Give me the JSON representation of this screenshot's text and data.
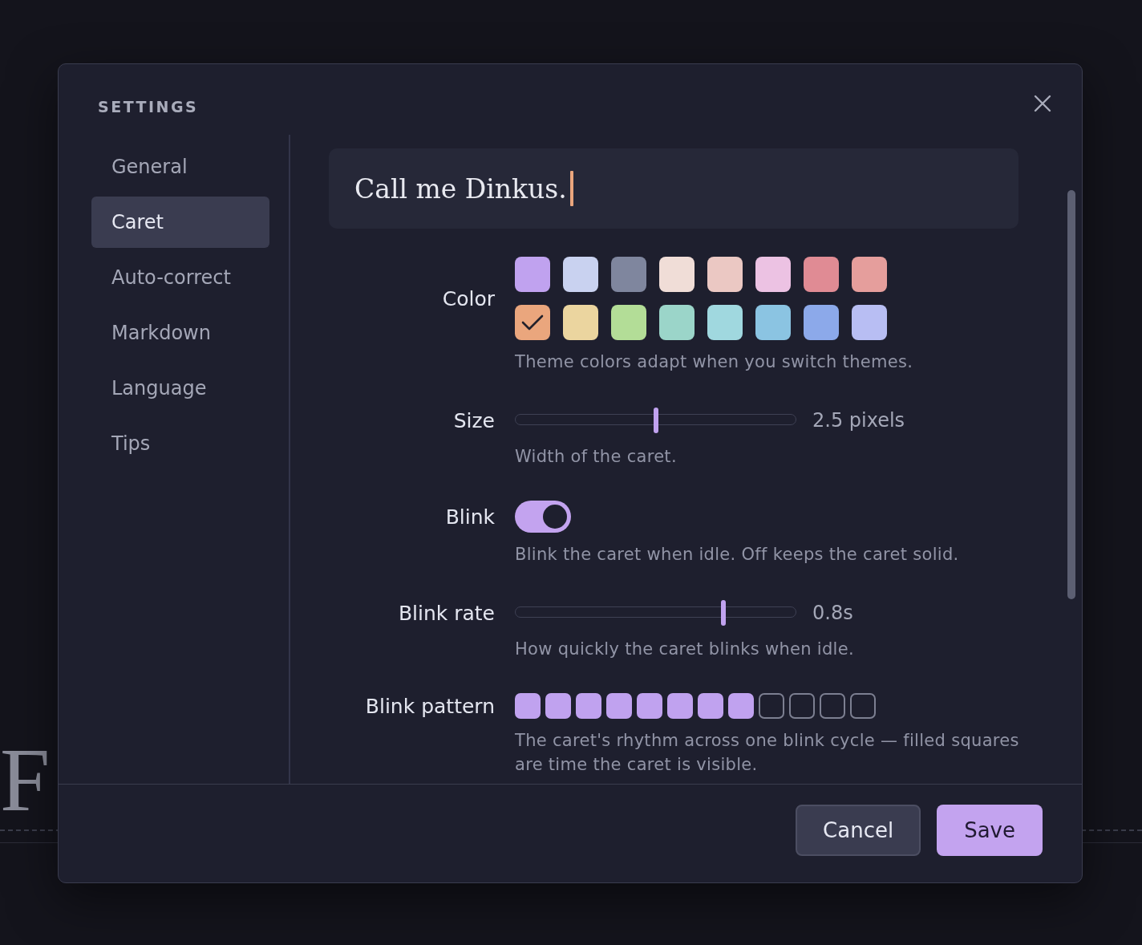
{
  "background": {
    "heading": "F"
  },
  "dialog": {
    "title": "SETTINGS",
    "sidebar": {
      "items": [
        {
          "label": "General",
          "selected": false
        },
        {
          "label": "Caret",
          "selected": true
        },
        {
          "label": "Auto-correct",
          "selected": false
        },
        {
          "label": "Markdown",
          "selected": false
        },
        {
          "label": "Language",
          "selected": false
        },
        {
          "label": "Tips",
          "selected": false
        }
      ]
    },
    "preview": {
      "text": "Call me Dinkus."
    },
    "settings": [
      {
        "kind": "colors",
        "label": "Color",
        "hint": "Theme colors adapt when you switch themes.",
        "swatches": [
          {
            "color": "#c0a2ef",
            "selected": false
          },
          {
            "color": "#c9d2f0",
            "selected": false
          },
          {
            "color": "#7f869e",
            "selected": false
          },
          {
            "color": "#f0ddd7",
            "selected": false
          },
          {
            "color": "#ebc8c3",
            "selected": false
          },
          {
            "color": "#ecc2e3",
            "selected": false
          },
          {
            "color": "#e08b94",
            "selected": false
          },
          {
            "color": "#e59e9c",
            "selected": false
          },
          {
            "color": "#eaa67d",
            "selected": true
          },
          {
            "color": "#ebd59f",
            "selected": false
          },
          {
            "color": "#b3dd97",
            "selected": false
          },
          {
            "color": "#9bd5c9",
            "selected": false
          },
          {
            "color": "#a0d8df",
            "selected": false
          },
          {
            "color": "#8bc4e2",
            "selected": false
          },
          {
            "color": "#8ca9ea",
            "selected": false
          },
          {
            "color": "#b8bef3",
            "selected": false
          }
        ]
      },
      {
        "kind": "slider",
        "label": "Size",
        "level": 0.5,
        "reading": "2.5 pixels",
        "hint": "Width of the caret."
      },
      {
        "kind": "toggle",
        "label": "Blink",
        "on": true,
        "hint": "Blink the caret when idle. Off keeps the caret solid."
      },
      {
        "kind": "slider",
        "label": "Blink rate",
        "level": 0.74,
        "reading": "0.8s",
        "hint": "How quickly the caret blinks when idle."
      },
      {
        "kind": "pattern",
        "label": "Blink pattern",
        "hint": "The caret's rhythm across one blink cycle — filled squares are time the caret is visible.",
        "cells": [
          {
            "filled": true
          },
          {
            "filled": true
          },
          {
            "filled": true
          },
          {
            "filled": true
          },
          {
            "filled": true
          },
          {
            "filled": true
          },
          {
            "filled": true
          },
          {
            "filled": true
          },
          {
            "filled": false
          },
          {
            "filled": false
          },
          {
            "filled": false
          },
          {
            "filled": false
          }
        ]
      }
    ],
    "buttons": [
      {
        "label": "Cancel",
        "kind": "secondary"
      },
      {
        "label": "Save",
        "kind": "primary"
      }
    ]
  }
}
